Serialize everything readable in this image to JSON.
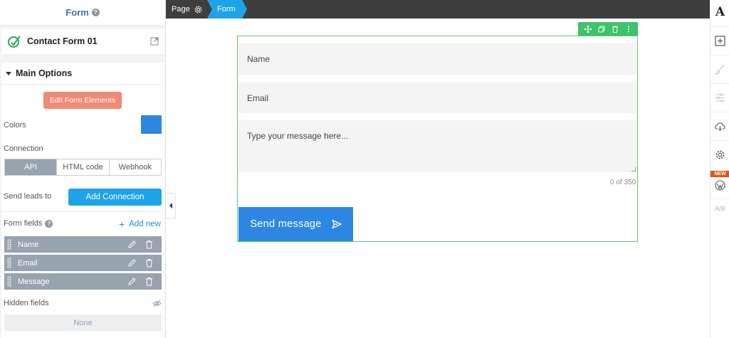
{
  "left_panel": {
    "title": "Form",
    "form_name": "Contact Form 01",
    "section_title": "Main Options",
    "edit_button": "Edit Form Elements",
    "colors_label": "Colors",
    "color_value": "#2d87e2",
    "connection_label": "Connection",
    "connection_tabs": [
      "API",
      "HTML code",
      "Webhook"
    ],
    "send_leads_label": "Send leads to",
    "add_connection": "Add Connection",
    "form_fields_label": "Form fields",
    "add_new": "Add new",
    "fields": [
      "Name",
      "Email",
      "Message"
    ],
    "hidden_fields_label": "Hidden fields",
    "hidden_fields_value": "None"
  },
  "topbar": {
    "page_label": "Page",
    "form_label": "Form"
  },
  "form": {
    "name_placeholder": "Name",
    "email_placeholder": "Email",
    "message_placeholder": "Type your message here...",
    "counter": "0 of 350",
    "submit_label": "Send message"
  },
  "right_sidebar": {
    "logo": "A",
    "new_badge": "NEW",
    "ab_label": "A/B",
    "icons": [
      "plus-square-icon",
      "brush-icon",
      "sliders-icon",
      "cloud-download-icon",
      "gear-icon",
      "wordpress-icon",
      "ab-test-icon"
    ]
  },
  "colors": {
    "accent": "#1da3e8",
    "primary_button": "#2d87e2",
    "edit_button": "#ef8b76",
    "selection": "#3ec26b",
    "new_badge": "#e2541b"
  }
}
